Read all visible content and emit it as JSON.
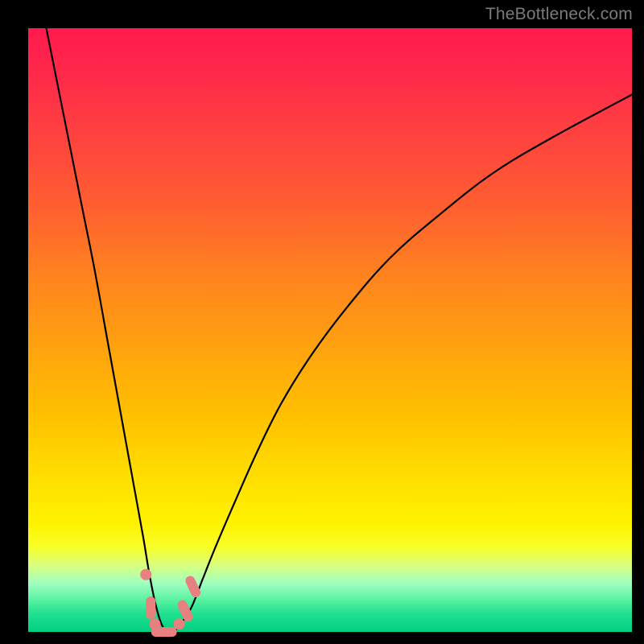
{
  "attribution": "TheBottleneck.com",
  "colors": {
    "gradient_top": "#ff1a4d",
    "gradient_mid": "#ffe000",
    "gradient_bottom": "#00d080",
    "curve": "#000000",
    "marker": "#e88080",
    "frame": "#000000"
  },
  "chart_data": {
    "type": "line",
    "title": "",
    "xlabel": "",
    "ylabel": "",
    "xlim": [
      0,
      100
    ],
    "ylim": [
      0,
      100
    ],
    "grid": false,
    "legend": false,
    "series": [
      {
        "name": "bottleneck-curve",
        "x": [
          3,
          5,
          7,
          9,
          11,
          13,
          15,
          17,
          19,
          20,
          21,
          22,
          23,
          24,
          25,
          27,
          29,
          31,
          34,
          38,
          42,
          47,
          53,
          60,
          68,
          77,
          87,
          100
        ],
        "y": [
          100,
          90,
          80,
          70,
          60,
          49,
          38,
          27,
          16,
          10,
          5,
          1.5,
          0,
          0,
          1,
          4,
          9,
          14,
          21,
          30,
          38,
          46,
          54,
          62,
          69,
          76,
          82,
          89
        ]
      }
    ],
    "markers": [
      {
        "x": 19.5,
        "y": 9.5,
        "shape": "circle"
      },
      {
        "x": 20.3,
        "y": 4.0,
        "shape": "capsule-v"
      },
      {
        "x": 21.0,
        "y": 1.3,
        "shape": "circle"
      },
      {
        "x": 22.5,
        "y": 0.0,
        "shape": "capsule-h"
      },
      {
        "x": 25.0,
        "y": 1.3,
        "shape": "circle"
      },
      {
        "x": 26.0,
        "y": 3.5,
        "shape": "capsule-d"
      },
      {
        "x": 27.3,
        "y": 7.5,
        "shape": "capsule-d"
      }
    ]
  }
}
